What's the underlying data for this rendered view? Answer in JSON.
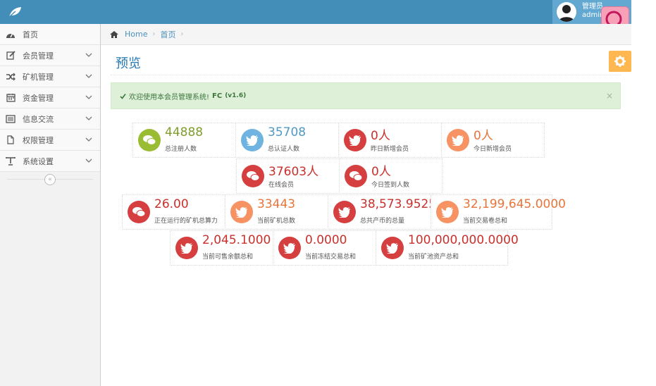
{
  "navbar": {
    "user_line1": "管理员",
    "user_line2": "admin"
  },
  "sidebar": {
    "items": [
      {
        "label": "首页",
        "icon": "tachometer-icon"
      },
      {
        "label": "会员管理",
        "icon": "edit-icon"
      },
      {
        "label": "矿机管理",
        "icon": "random-icon"
      },
      {
        "label": "资金管理",
        "icon": "calendar-icon"
      },
      {
        "label": "信息交流",
        "icon": "list-alt-icon"
      },
      {
        "label": "权限管理",
        "icon": "file-icon"
      },
      {
        "label": "系统设置",
        "icon": "text-width-icon"
      }
    ],
    "collapse_label": "«"
  },
  "breadcrumb": {
    "home": "Home",
    "sep": "›",
    "current": "首页"
  },
  "page": {
    "title": "预览"
  },
  "alert": {
    "text": "欢迎使用本会员管理系统!",
    "brand": "FC",
    "version": "(v1.6)",
    "close": "×"
  },
  "stats": {
    "r1": [
      {
        "value": "44888",
        "label": "总注册人数",
        "color": "#9abc32",
        "icon": "comments-icon"
      },
      {
        "value": "35708",
        "label": "总认证人数",
        "color": "#6fb3e0",
        "icon": "twitter-icon"
      },
      {
        "value": "0人",
        "label": "昨日新增会员",
        "color": "#d53f40",
        "icon": "twitter-icon"
      },
      {
        "value": "0人",
        "label": "今日新增会员",
        "color": "#f79263",
        "icon": "twitter-icon"
      }
    ],
    "r2": [
      {
        "value": "37603人",
        "label": "在线会员",
        "color": "#d53f40",
        "icon": "comments-icon"
      },
      {
        "value": "0人",
        "label": "今日签到人数",
        "color": "#d53f40",
        "icon": "comments-icon"
      }
    ],
    "r3": [
      {
        "value": "26.00",
        "label": "正在运行的矿机总算力",
        "color": "#d53f40",
        "icon": "comments-icon"
      },
      {
        "value": "33443",
        "label": "当前矿机总数",
        "color": "#f79263",
        "icon": "twitter-icon"
      },
      {
        "value": "38,573.9525",
        "label": "总共产币的总量",
        "color": "#d53f40",
        "icon": "twitter-icon"
      },
      {
        "value": "32,199,645.0000",
        "label": "当前交易卷总和",
        "color": "#f79263",
        "icon": "twitter-icon"
      }
    ],
    "r4": [
      {
        "value": "2,045.1000",
        "label": "当前可售余额总和",
        "color": "#d53f40",
        "icon": "twitter-icon"
      },
      {
        "value": "0.0000",
        "label": "当前冻结交易总和",
        "color": "#d53f40",
        "icon": "twitter-icon"
      },
      {
        "value": "100,000,000.0000",
        "label": "当前矿池资产总和",
        "color": "#d53f40",
        "icon": "twitter-icon"
      }
    ]
  }
}
